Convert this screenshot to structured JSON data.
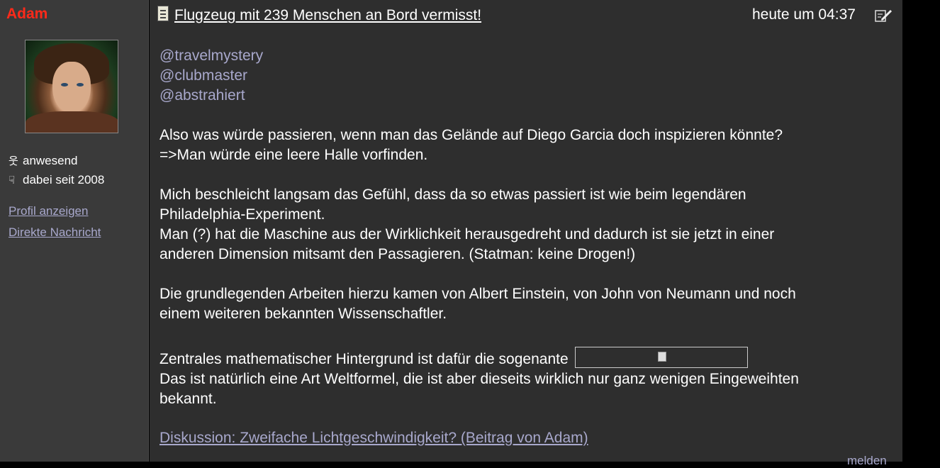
{
  "user": {
    "name": "Adam",
    "status": "anwesend",
    "member_since": "dabei seit 2008",
    "profile_link": "Profil anzeigen",
    "message_link": "Direkte Nachricht"
  },
  "post": {
    "title": "Flugzeug mit 239 Menschen an Bord vermisst!",
    "timestamp": "heute um 04:37",
    "mentions": [
      "@travelmystery",
      "@clubmaster",
      "@abstrahiert"
    ],
    "paragraphs": [
      [
        "Also was würde passieren, wenn man das Gelände auf Diego Garcia doch inspizieren könnte?",
        "=>Man würde eine leere Halle vorfinden."
      ],
      [
        "Mich beschleicht langsam das Gefühl, dass da so etwas passiert ist wie beim legendären",
        "Philadelphia-Experiment.",
        "Man (?) hat die Maschine aus der Wirklichkeit herausgedreht und dadurch ist sie jetzt in einer",
        "anderen Dimension mitsamt den Passagieren. (Statman: keine Drogen!)"
      ],
      [
        "Die grundlegenden Arbeiten hierzu kamen von Albert Einstein, von John von Neumann und noch",
        "einem weiteren bekannten Wissenschaftler."
      ],
      [
        "Zentrales mathematischer Hintergrund ist dafür die sogenante",
        "Das ist natürlich eine Art Weltformel, die ist aber dieseits wirklich nur ganz wenigen Eingeweihten",
        "bekannt."
      ]
    ],
    "discussion_link": "Diskussion: Zweifache Lichtgeschwindigkeit? (Beitrag von Adam)",
    "report_link": "melden"
  },
  "colors": {
    "username": "#ff2a1a",
    "link": "#a8a8cc",
    "text": "#ffffff",
    "post_bg": "#2e2e2e",
    "sidebar_bg": "#3a3a3a"
  },
  "icons": [
    "status-person-icon",
    "member-hand-icon",
    "post-document-icon",
    "edit-pencil-icon",
    "broken-image-icon"
  ]
}
